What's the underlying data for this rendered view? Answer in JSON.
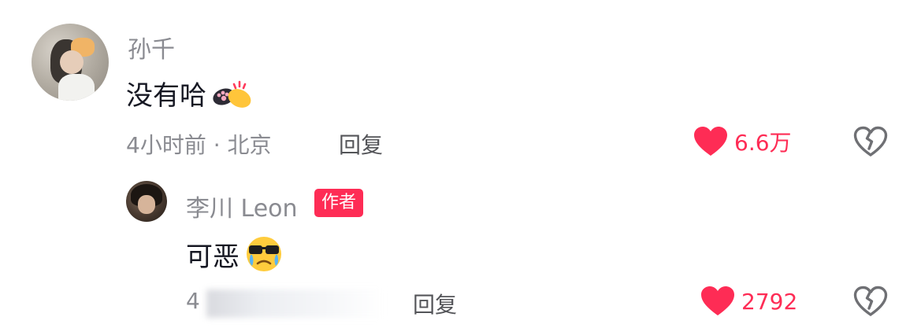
{
  "comment": {
    "username": "孙千",
    "text": "没有哈",
    "emoji_icon": "paw-handshake-emoji",
    "time_location": "4小时前 · 北京",
    "reply_label": "回复",
    "like_count": "6.6万",
    "like_color": "#fe2c55"
  },
  "reply": {
    "username": "李川 Leon",
    "badge": "作者",
    "text": "可恶",
    "emoji_icon": "crying-sunglasses-emoji",
    "time_prefix": "4",
    "reply_label": "回复",
    "like_count": "2792"
  }
}
